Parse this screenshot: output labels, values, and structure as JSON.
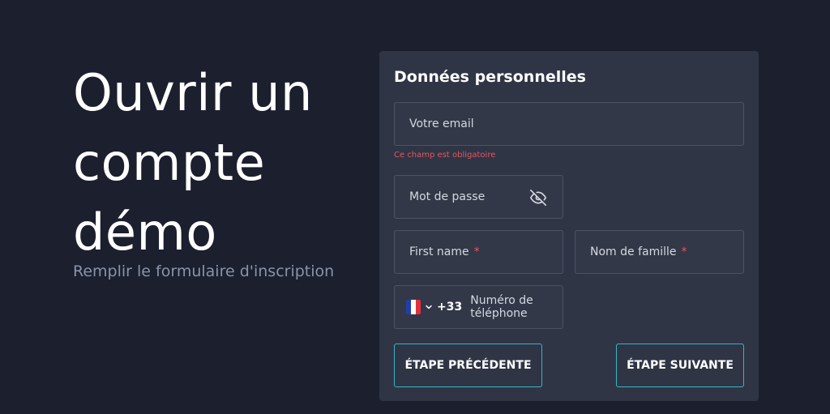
{
  "hero": {
    "title": "Ouvrir un compte démo",
    "subtitle": "Remplir le formulaire d'inscription"
  },
  "form": {
    "title": "Données personnelles",
    "email_placeholder": "Votre email",
    "email_error": "Ce champ est obligatoire",
    "password_placeholder": "Mot de passe",
    "password_toggle_icon": "eye-off-icon",
    "first_name_placeholder": "First name",
    "last_name_placeholder": "Nom de famille",
    "required_marker": "*",
    "phone": {
      "country_flag_icon": "flag-france-icon",
      "dial_code": "+33",
      "placeholder": "Numéro de téléphone"
    },
    "prev_button": "ÉTAPE PRÉCÉDENTE",
    "next_button": "ÉTAPE SUIVANTE"
  },
  "colors": {
    "background": "#1b1f2e",
    "card": "#2f3545",
    "accent": "#3bb4c4",
    "error": "#e8545f"
  }
}
